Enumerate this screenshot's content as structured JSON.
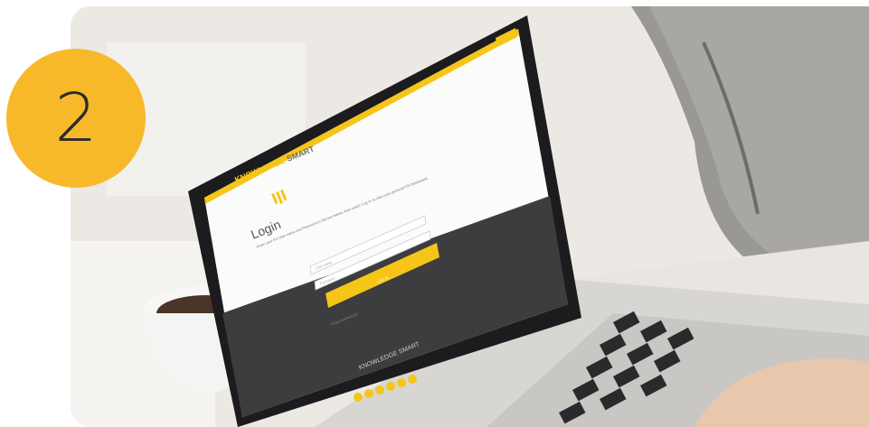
{
  "step": {
    "number": "2"
  },
  "screen": {
    "brand_line1": "KNOWLEDGE",
    "brand_line2": "SMART",
    "login_title": "Login",
    "instructions": "Enter your KS User name and Password in the box below, then select 'Log in' to view your personal KS Dashboard.",
    "username_placeholder": "User name",
    "password_placeholder": "Password",
    "login_button": "LOG IN",
    "forgot_password": "Forgot password?",
    "footer_brand_line1": "KNOWLEDGE",
    "footer_brand_line2": "SMART"
  },
  "colors": {
    "accent": "#f7b92a",
    "screen_yellow": "#f5c518",
    "footer_dark": "#3d3d3f",
    "laptop_body": "#1c1c1e"
  }
}
